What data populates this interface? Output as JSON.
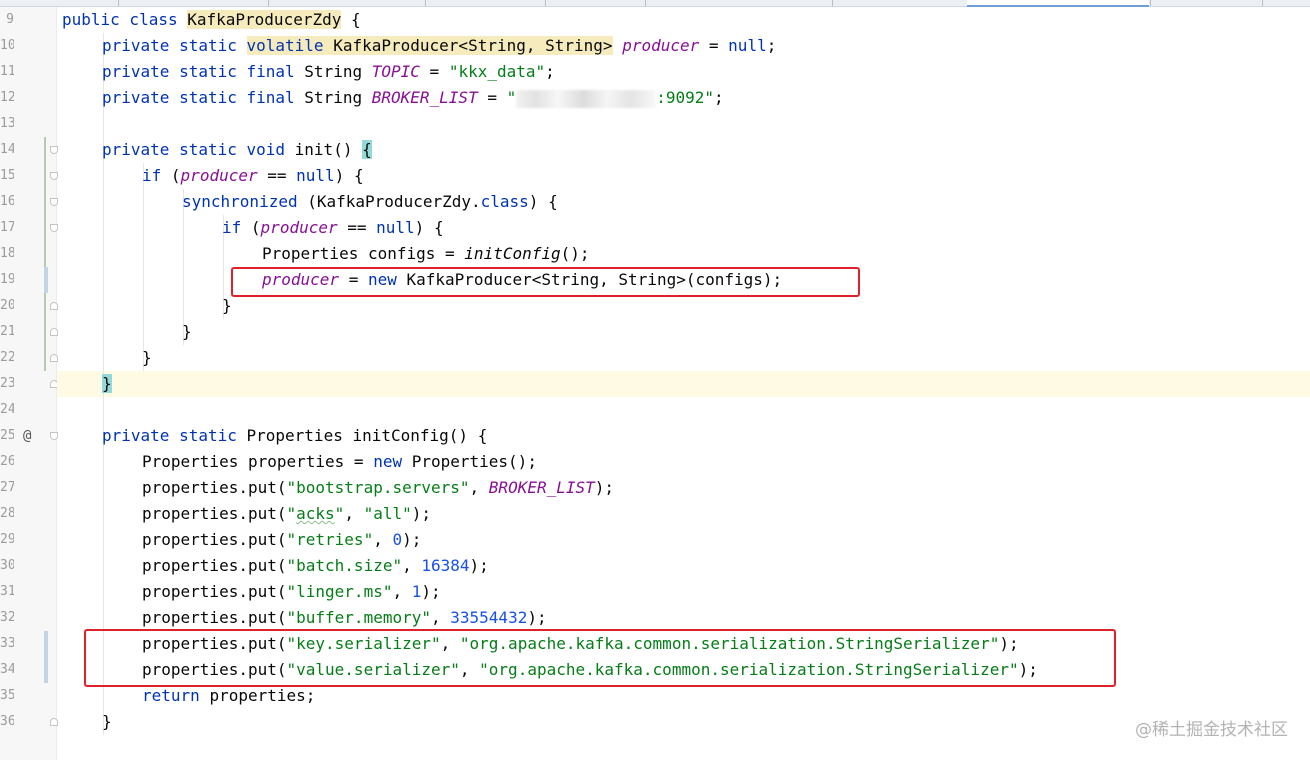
{
  "gutter": {
    "line_numbers": [
      "9",
      "10",
      "11",
      "12",
      "13",
      "14",
      "15",
      "16",
      "17",
      "18",
      "19",
      "20",
      "21",
      "22",
      "23",
      "24",
      "25",
      "26",
      "27",
      "28",
      "29",
      "30",
      "31",
      "32",
      "33",
      "34",
      "35",
      "36"
    ]
  },
  "code": {
    "l1": [
      "public class ",
      "KafkaProducerZdy",
      " {"
    ],
    "l2": [
      "private static ",
      "volatile ",
      "KafkaProducer<String, String>",
      " ",
      "producer",
      " = ",
      "null",
      ";"
    ],
    "l3": [
      "private static final ",
      "String ",
      "TOPIC",
      " = ",
      "\"kkx_data\"",
      ";"
    ],
    "l4": [
      "private static final ",
      "String ",
      "BROKER_LIST",
      " = ",
      "\"",
      ":9092\"",
      ";"
    ],
    "l6": [
      "private static void ",
      "init() ",
      "{"
    ],
    "l7": [
      "if ",
      "(",
      "producer",
      " == ",
      "null",
      ") {"
    ],
    "l8": [
      "synchronized ",
      "(KafkaProducerZdy.",
      "class",
      ") {"
    ],
    "l9": [
      "if ",
      "(",
      "producer",
      " == ",
      "null",
      ") {"
    ],
    "l10": [
      "Properties configs = ",
      "initConfig",
      "();"
    ],
    "l11": [
      "producer",
      " = ",
      "new ",
      "KafkaProducer<String, String>(configs);"
    ],
    "l12": "}",
    "l13": "}",
    "l14": "}",
    "l15": "}",
    "l17": [
      "private static ",
      "Properties initConfig() {"
    ],
    "l18": [
      "Properties properties = ",
      "new ",
      "Properties();"
    ],
    "l19": [
      "properties.put(",
      "\"bootstrap.servers\"",
      ", ",
      "BROKER_LIST",
      ");"
    ],
    "l20": [
      "properties.put(",
      "\"",
      "acks",
      "\"",
      ", ",
      "\"all\"",
      ");"
    ],
    "l21": [
      "properties.put(",
      "\"retries\"",
      ", ",
      "0",
      ");"
    ],
    "l22": [
      "properties.put(",
      "\"batch.size\"",
      ", ",
      "16384",
      ");"
    ],
    "l23": [
      "properties.put(",
      "\"linger.ms\"",
      ", ",
      "1",
      ");"
    ],
    "l24": [
      "properties.put(",
      "\"buffer.memory\"",
      ", ",
      "33554432",
      ");"
    ],
    "l25": [
      "properties.put(",
      "\"key.serializer\"",
      ", ",
      "\"org.apache.kafka.common.serialization.StringSerializer\"",
      ");"
    ],
    "l26": [
      "properties.put(",
      "\"value.serializer\"",
      ", ",
      "\"org.apache.kafka.common.serialization.StringSerializer\"",
      ");"
    ],
    "l27": [
      "return ",
      "properties;"
    ],
    "l28": "}"
  },
  "watermark": "@稀土掘金技术社区",
  "colors": {
    "keyword": "#0033b3",
    "string": "#067d17",
    "number": "#1750eb",
    "field": "#871094",
    "annotation_box": "#e0202a",
    "current_line": "#fffae3"
  },
  "icons": {
    "gutter_marker": "@"
  }
}
